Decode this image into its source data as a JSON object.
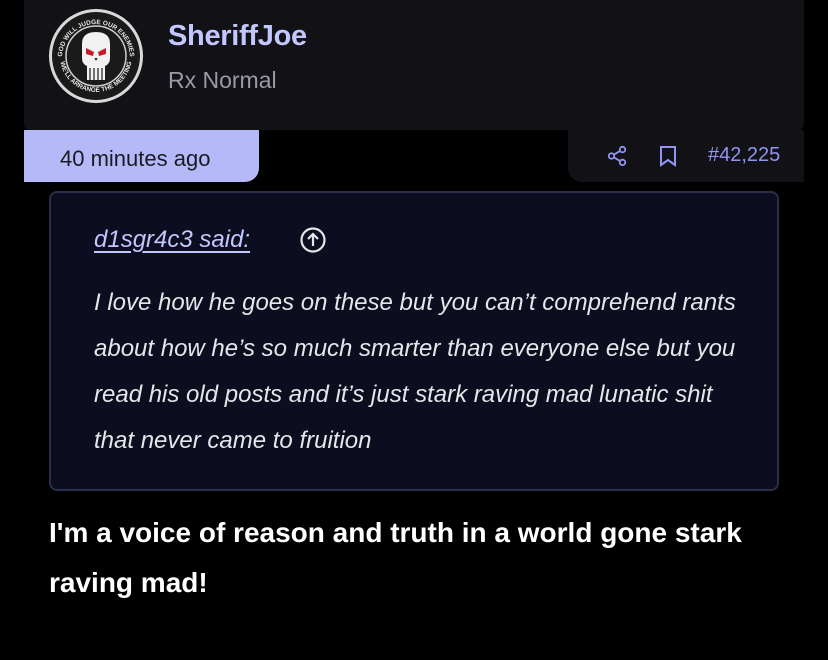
{
  "user": {
    "name": "SheriffJoe",
    "title": "Rx Normal",
    "avatar": {
      "top_text": "GOD WILL JUDGE OUR ENEMIES",
      "bottom_text": "WE'LL ARRANGE THE MEETING",
      "icon": "punisher-skull-icon"
    }
  },
  "post": {
    "time": "40 minutes ago",
    "number": "#42,225",
    "share_icon": "share-icon",
    "bookmark_icon": "bookmark-icon",
    "quote": {
      "author": "d1sgr4c3 said:",
      "jump_icon": "arrow-up-circle-icon",
      "text": "I love how he goes on these but you can’t comprehend rants about how he’s so much smarter than everyone else but you read his old posts and it’s just stark raving mad lunatic shit that never came to fruition"
    },
    "message": "I'm a voice of reason and truth in a world gone stark raving mad!"
  },
  "colors": {
    "accent": "#b6b9f7",
    "link": "#8f95f0",
    "username": "#c3c7ff",
    "quote_bg": "#0c0e1f"
  }
}
